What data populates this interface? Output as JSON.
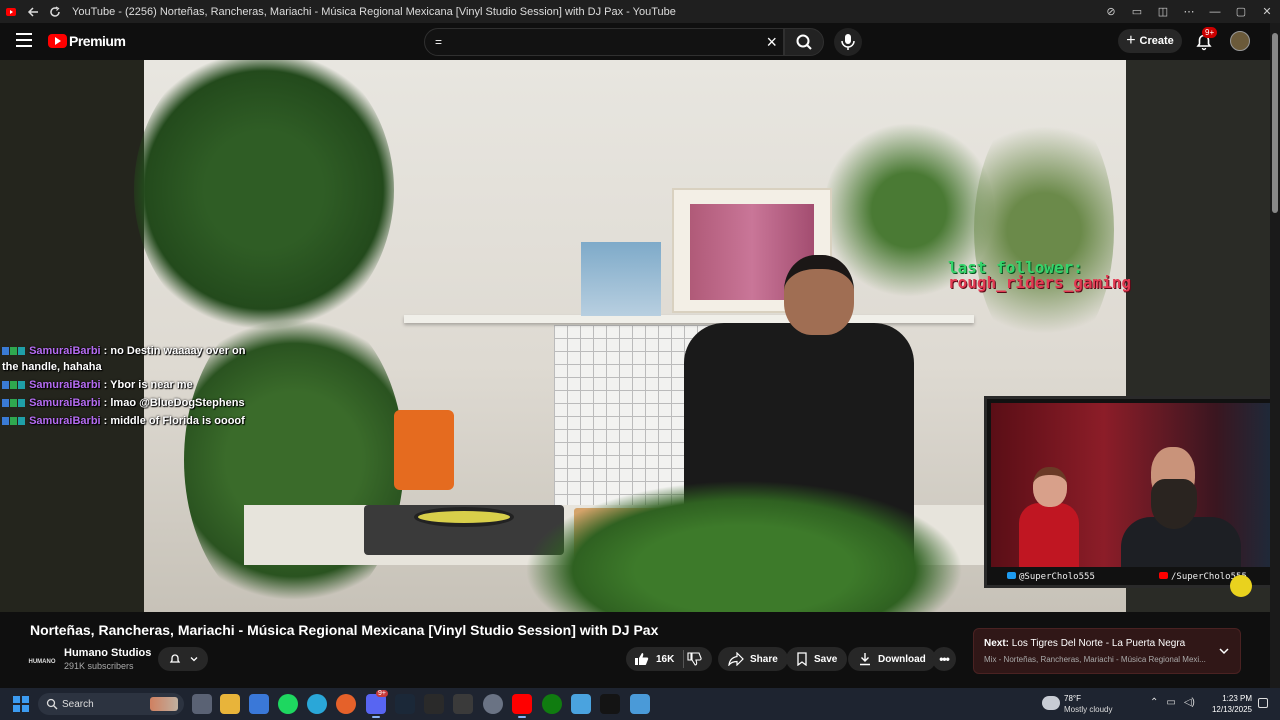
{
  "window": {
    "title": "YouTube - (2256) Norteñas, Rancheras, Mariachi - Música Regional Mexicana [Vinyl Studio Session] with DJ Pax - YouTube"
  },
  "header": {
    "logo_text": "Premium",
    "search_value": "=",
    "create_label": "Create",
    "notification_badge": "9+"
  },
  "chat": {
    "messages": [
      {
        "user": "SamuraiBarbi",
        "text": ": no Destin waaaay over on the handle, hahaha"
      },
      {
        "user": "SamuraiBarbi",
        "text": ": Ybor is near me"
      },
      {
        "user": "SamuraiBarbi",
        "text": ": lmao @BlueDogStephens"
      },
      {
        "user": "SamuraiBarbi",
        "text": ": middle of Florida is oooof"
      }
    ]
  },
  "overlay": {
    "follower_label": "last follower:",
    "follower_name": "rough_riders_gaming",
    "twitter_handle": "@SuperCholo555",
    "youtube_handle": "/SuperCholo555"
  },
  "video": {
    "title": "Norteñas, Rancheras, Mariachi - Música Regional Mexicana [Vinyl Studio Session] with DJ Pax",
    "channel_name": "Humano Studios",
    "channel_logo_text": "HUMANO",
    "subscribers": "291K subscribers",
    "likes": "16K",
    "share_label": "Share",
    "save_label": "Save",
    "download_label": "Download"
  },
  "next": {
    "prefix": "Next:",
    "title": "Los Tigres Del Norte - La Puerta Negra",
    "subtitle": "Mix - Norteñas, Rancheras, Mariachi - Música Regional Mexi..."
  },
  "taskbar": {
    "search_label": "Search",
    "badge": "9+",
    "weather_temp": "78°F",
    "weather_desc": "Mostly cloudy",
    "time": "1:23 PM",
    "date": "12/13/2025"
  },
  "colors": {
    "accent_red": "#ff0000",
    "chat_user": "#b56cf2",
    "follower_label": "#35d46b",
    "follower_name": "#e23a52"
  }
}
